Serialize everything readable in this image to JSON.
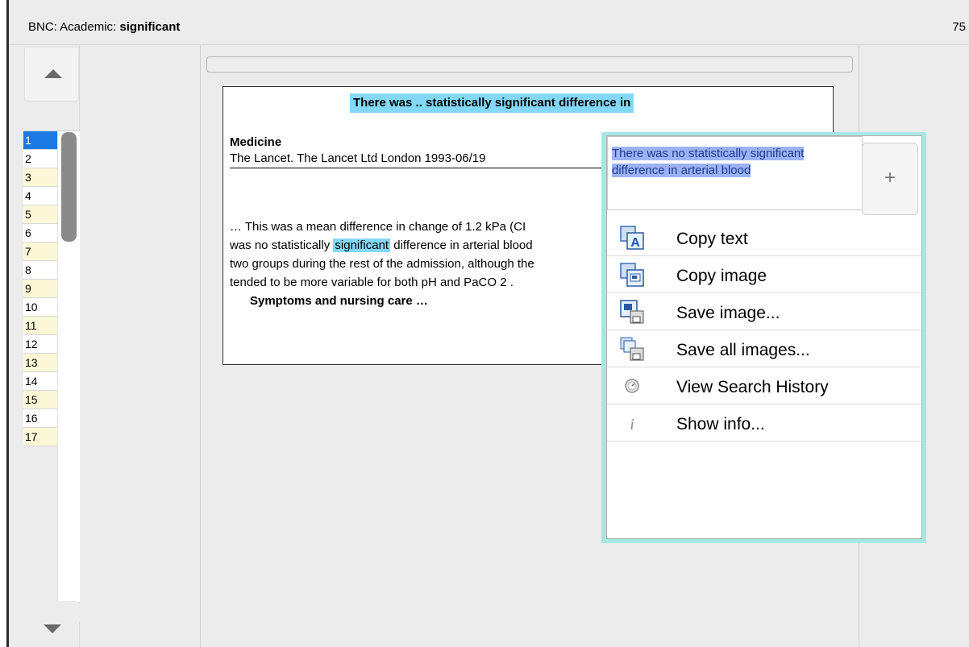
{
  "header": {
    "prefix": "BNC: Academic:",
    "keyword": "significant",
    "count": "75"
  },
  "nav": {
    "rows": [
      "1",
      "2",
      "3",
      "4",
      "5",
      "6",
      "7",
      "8",
      "9",
      "10",
      "11",
      "12",
      "13",
      "14",
      "15",
      "16",
      "17"
    ],
    "selected": "1"
  },
  "card": {
    "heading": "There was .. statistically significant difference in",
    "genre": "Medicine",
    "source": "The Lancet. The Lancet Ltd London 1993-06/19",
    "excerpt": {
      "line1": "…  This was a mean difference in change of 1.2 kPa (CI",
      "line2_before": "was no statistically ",
      "line2_hl": "significant",
      "line2_after": " difference in arterial blood",
      "line3": "two groups during the rest of the admission, although the",
      "line4": "tended to be more variable for both pH and PaCO 2 .",
      "line5": "Symptoms and nursing care …"
    }
  },
  "popup": {
    "selected_text": "There was no statistically significant difference in arterial blood",
    "plus": "+",
    "menu": [
      {
        "label": "Copy text",
        "icon": "copy-text-icon"
      },
      {
        "label": "Copy image",
        "icon": "copy-image-icon"
      },
      {
        "label": "Save image...",
        "icon": "save-image-icon"
      },
      {
        "label": "Save all images...",
        "icon": "save-all-images-icon"
      },
      {
        "label": "View Search History",
        "icon": "history-icon"
      },
      {
        "label": "Show info...",
        "icon": "info-icon"
      }
    ]
  },
  "colors": {
    "highlight": "#84d8f7",
    "selection": "#1b79e3",
    "row_alt": "#fbf8d8",
    "popup_border": "#a6e7e2"
  }
}
